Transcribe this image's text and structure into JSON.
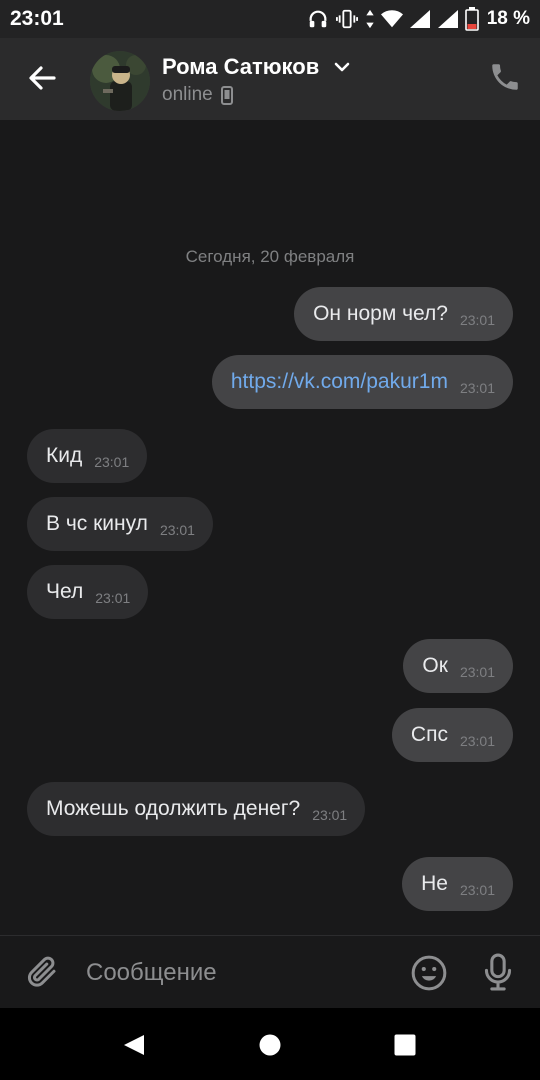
{
  "status_bar": {
    "time": "23:01",
    "battery_percent": "18 %",
    "icons": [
      "headphones-icon",
      "vibrate-icon",
      "data-arrows-icon",
      "wifi-icon",
      "signal-icon",
      "signal-icon",
      "battery-icon"
    ]
  },
  "header": {
    "contact_name": "Рома Сатюков",
    "presence": "online",
    "icons": [
      "back-arrow-icon",
      "chevron-down-icon",
      "mobile-device-icon",
      "phone-icon"
    ]
  },
  "chat": {
    "date_separator": "Сегодня, 20 февраля",
    "messages": [
      {
        "direction": "out",
        "text": "Он норм чел?",
        "time": "23:01"
      },
      {
        "direction": "out",
        "text": "https://vk.com/pakur1m",
        "time": "23:01",
        "is_link": true
      },
      {
        "direction": "in",
        "text": "Кид",
        "time": "23:01"
      },
      {
        "direction": "in",
        "text": "В чс кинул",
        "time": "23:01"
      },
      {
        "direction": "in",
        "text": "Чел",
        "time": "23:01"
      },
      {
        "direction": "out",
        "text": "Ок",
        "time": "23:01"
      },
      {
        "direction": "out",
        "text": "Спс",
        "time": "23:01"
      },
      {
        "direction": "in",
        "text": "Можешь одолжить денег?",
        "time": "23:01"
      },
      {
        "direction": "out",
        "text": "Не",
        "time": "23:01"
      }
    ]
  },
  "composer": {
    "placeholder": "Сообщение",
    "value": "",
    "icons": [
      "paperclip-icon",
      "emoji-icon",
      "microphone-icon"
    ]
  },
  "nav_bar": {
    "icons": [
      "nav-back-icon",
      "nav-home-icon",
      "nav-recents-icon"
    ]
  },
  "colors": {
    "background": "#19191a",
    "header": "#2b2b2c",
    "incoming_bubble": "#2d2d2f",
    "outgoing_bubble": "#444446",
    "link": "#71aaeb",
    "secondary_text": "#8d8e90"
  }
}
